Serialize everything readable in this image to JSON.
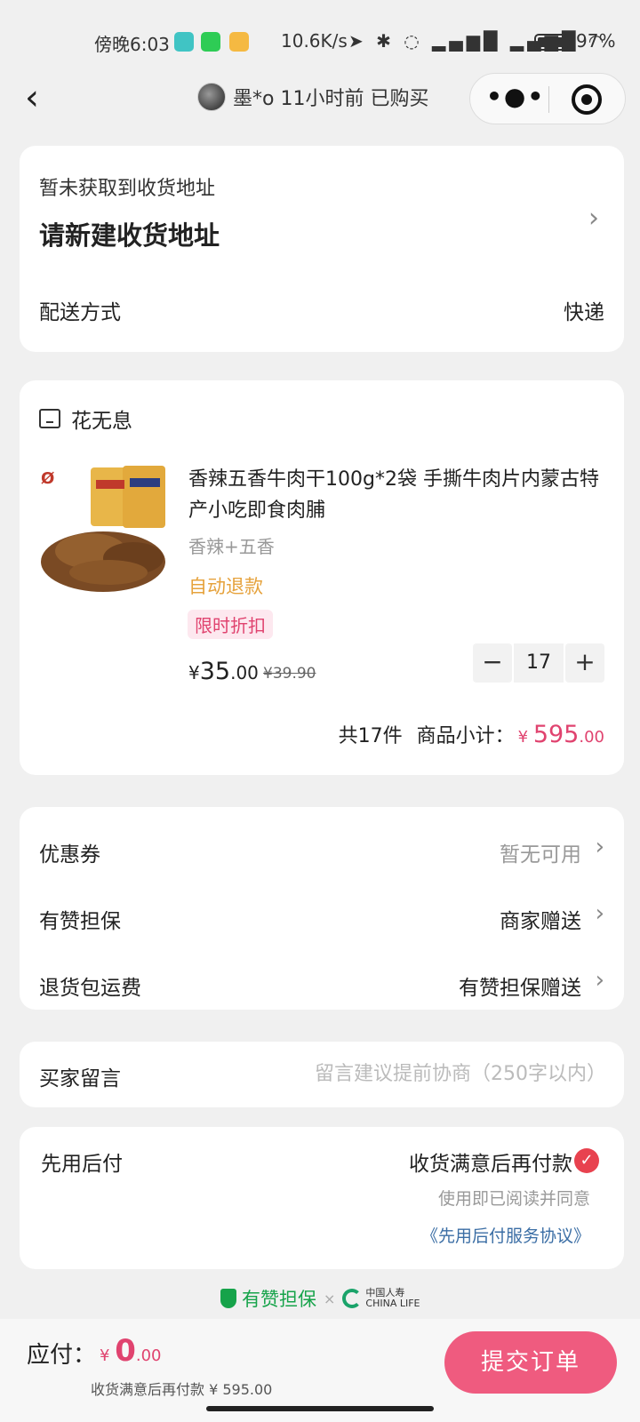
{
  "status_bar": {
    "time": "傍晚6:03",
    "speed": "10.6K/s",
    "battery": "97%"
  },
  "nav": {
    "buyer_text": "墨*o 11小时前 已购买"
  },
  "address": {
    "hint": "暂未获取到收货地址",
    "main": "请新建收货地址",
    "shipping_label": "配送方式",
    "shipping_value": "快递"
  },
  "product": {
    "shop_name": "花无息",
    "title": "香辣五香牛肉干100g*2袋 手撕牛肉片内蒙古特产小吃即食肉脯",
    "spec": "香辣+五香",
    "refund": "自动退款",
    "tag": "限时折扣",
    "price_symbol": "¥",
    "price_int": "35",
    "price_dec": ".00",
    "orig_price": "¥39.90",
    "quantity": "17",
    "minus": "−",
    "plus": "+",
    "count_text": "共17件",
    "subtotal_label": "商品小计：",
    "subtotal_symbol": "¥",
    "subtotal_int": "595",
    "subtotal_dec": ".00"
  },
  "options": [
    {
      "label": "优惠券",
      "value": "暂无可用"
    },
    {
      "label": "有赞担保",
      "value": "商家赠送"
    },
    {
      "label": "退货包运费",
      "value": "有赞担保赠送"
    }
  ],
  "message": {
    "label": "买家留言",
    "placeholder": "留言建议提前协商（250字以内）"
  },
  "pay_later": {
    "label": "先用后付",
    "value": "收货满意后再付款",
    "agree": "使用即已阅读并同意",
    "link": "《先用后付服务协议》"
  },
  "guarantee": {
    "text": "有赞担保",
    "x": "×",
    "partner_cn": "中国人寿",
    "partner_en": "CHINA LIFE"
  },
  "bottom": {
    "due_label": "应付：",
    "due_symbol": "¥",
    "due_int": "0",
    "due_dec": ".00",
    "due_sub": "收货满意后再付款 ¥ 595.00",
    "submit": "提交订单"
  },
  "colors": {
    "accent": "#e0436f",
    "submit_bg": "#ef5b7f",
    "refund": "#e6a23c",
    "guarantee": "#16a34a",
    "link": "#3b6ea5"
  }
}
